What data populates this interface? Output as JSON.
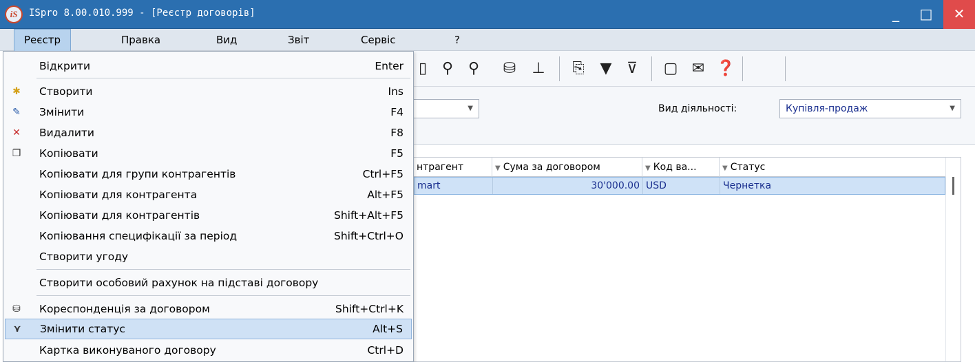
{
  "window": {
    "logo_text": "iS",
    "title": "ISpro 8.00.010.999 - [Реєстр договорів]",
    "minimize": "_",
    "maximize": "□",
    "close": "✕"
  },
  "menubar": {
    "items": [
      "Реєстр",
      "Правка",
      "Вид",
      "Звіт",
      "Сервіс",
      "?"
    ]
  },
  "toolbar": {
    "icons": [
      "document-icon",
      "search-icon",
      "search-next-icon",
      "correspondence-icon",
      "hierarchy-icon",
      "history-icon",
      "filter-icon",
      "clear-filter-icon",
      "form-icon",
      "mail-icon",
      "help-icon"
    ]
  },
  "filters": {
    "activity_label": "Вид діяльності:",
    "activity_value": "Купівля-продаж"
  },
  "grid": {
    "columns": [
      "нтрагент",
      "Сума за договором",
      "Код ва...",
      "Статус"
    ],
    "rows": [
      {
        "contractor": "mart",
        "amount": "30'000.00",
        "currency": "USD",
        "status": "Чернетка"
      }
    ]
  },
  "dropdown": {
    "items": [
      {
        "label": "Відкрити",
        "shortcut": "Enter",
        "icon": ""
      },
      {
        "label": "Створити",
        "shortcut": "Ins",
        "icon": "new-doc-icon"
      },
      {
        "label": "Змінити",
        "shortcut": "F4",
        "icon": "edit-doc-icon"
      },
      {
        "label": "Видалити",
        "shortcut": "F8",
        "icon": "delete-doc-icon"
      },
      {
        "label": "Копіювати",
        "shortcut": "F5",
        "icon": "copy-icon"
      },
      {
        "label": "Копіювати для групи контрагентів",
        "shortcut": "Ctrl+F5",
        "icon": ""
      },
      {
        "label": "Копіювати для контрагента",
        "shortcut": "Alt+F5",
        "icon": ""
      },
      {
        "label": "Копіювати для контрагентів",
        "shortcut": "Shift+Alt+F5",
        "icon": ""
      },
      {
        "label": "Копіювання специфікації за період",
        "shortcut": "Shift+Ctrl+O",
        "icon": ""
      },
      {
        "label": "Створити угоду",
        "shortcut": "",
        "icon": ""
      },
      {
        "label": "Створити особовий рахунок на підставі договору",
        "shortcut": "",
        "icon": ""
      },
      {
        "label": "Кореспонденція за договором",
        "shortcut": "Shift+Ctrl+K",
        "icon": "correspondence-icon"
      },
      {
        "label": "Змінити статус",
        "shortcut": "Alt+S",
        "icon": "change-status-icon"
      },
      {
        "label": "Картка виконуваного договору",
        "shortcut": "Ctrl+D",
        "icon": ""
      }
    ]
  }
}
